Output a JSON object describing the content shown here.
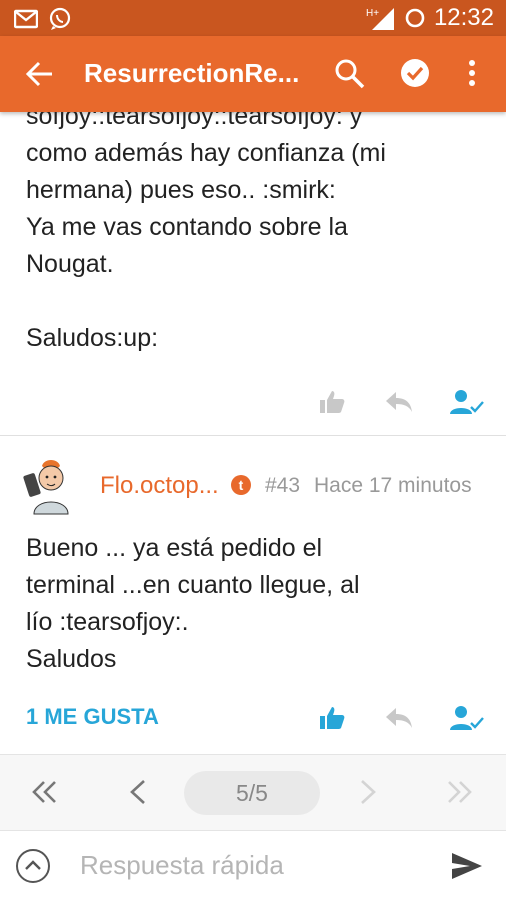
{
  "status_bar": {
    "time": "12:32",
    "notification_icons": [
      "gmail-icon",
      "whatsapp-icon"
    ],
    "network": "H+"
  },
  "app_bar": {
    "title": "ResurrectionRe...",
    "background": "#e8692c"
  },
  "posts": [
    {
      "text": "sofjoy::tearsofjoy::tearsofjoy: y\ncomo además hay confianza (mi\nhermana) pues eso.. :smirk:\nYa me vas contando sobre la\nNougat.\n\nSaludos:up:",
      "likes_label": ""
    },
    {
      "username": "Flo.octop...",
      "badge": "t",
      "number": "#43",
      "time": "Hace 17 minutos",
      "text": "Bueno ... ya está pedido el\nterminal ...en cuanto llegue, al\nlío :tearsofjoy:.\nSaludos",
      "likes_label": "1 ME GUSTA"
    }
  ],
  "pager": {
    "pages": "5/5"
  },
  "reply": {
    "placeholder": "Respuesta rápida"
  },
  "colors": {
    "accent": "#e8692c",
    "link": "#27a6d8"
  }
}
